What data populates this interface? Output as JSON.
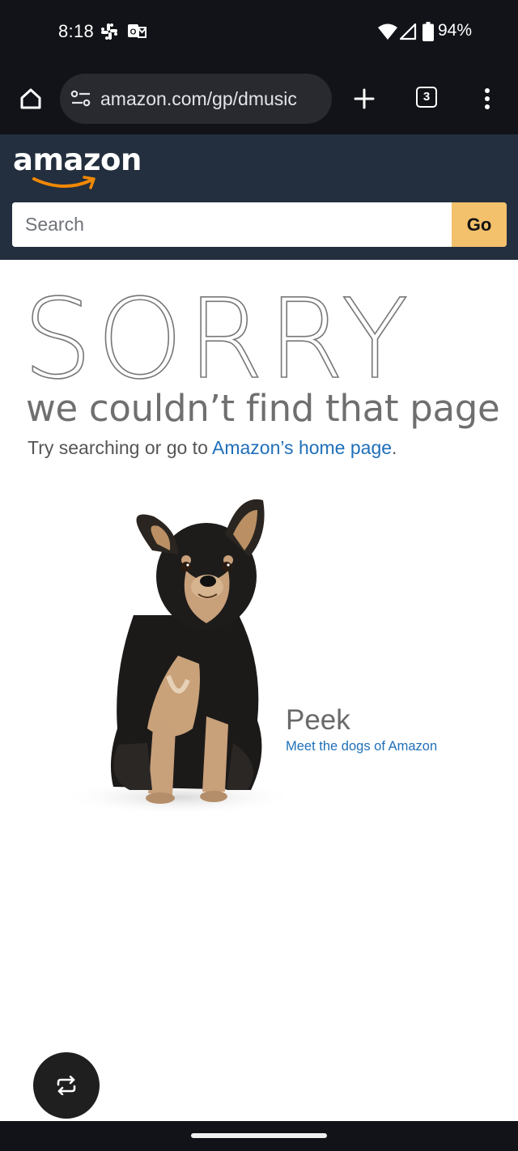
{
  "status_bar": {
    "time": "8:18",
    "battery": "94%",
    "icons": [
      "slack-icon",
      "outlook-icon",
      "wifi-icon",
      "cell-signal-icon",
      "battery-icon"
    ]
  },
  "browser": {
    "url": "amazon.com/gp/dmusic",
    "tab_count": "3",
    "icons": [
      "home-icon",
      "site-settings-icon",
      "new-tab-plus-icon",
      "tab-switcher-icon",
      "more-vert-icon"
    ]
  },
  "amazon": {
    "logo": "amazon",
    "search": {
      "placeholder": "Search",
      "value": "",
      "button_label": "Go"
    }
  },
  "error_page": {
    "title": "SORRY",
    "subtitle": "we couldn’t find that page",
    "help_prefix": "Try searching or go to ",
    "help_link": "Amazon’s home page",
    "help_suffix": "."
  },
  "dog": {
    "name": "Peek",
    "link": "Meet the dogs of Amazon"
  },
  "fab": {
    "icon": "rotate-icon"
  },
  "colors": {
    "system_bar": "#111318",
    "amazon_nav": "#232f3e",
    "go_button": "#f3c06c",
    "link": "#1f6fb8"
  }
}
